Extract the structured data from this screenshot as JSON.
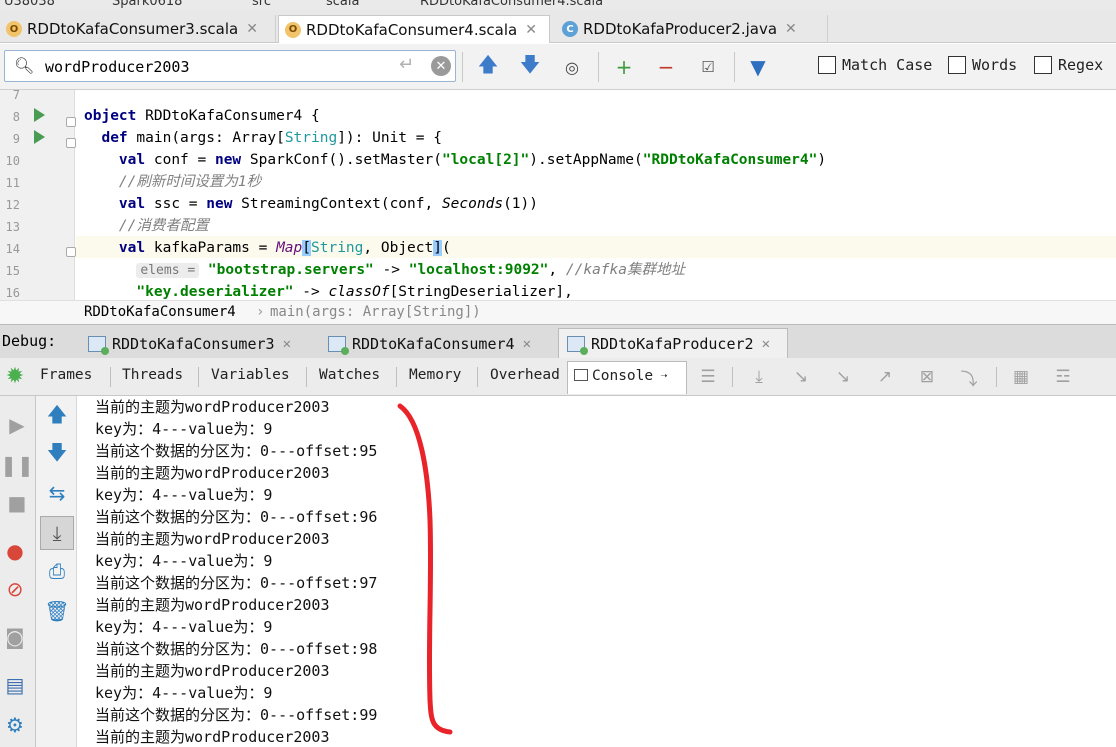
{
  "top_crumbs": [
    "U38038",
    "Spark0618",
    "src",
    "scala",
    "RDDtoKafaConsumer4.scala"
  ],
  "editor_tabs": [
    {
      "label": "RDDtoKafaConsumer3.scala",
      "icon": "scala-object-icon",
      "active": false
    },
    {
      "label": "RDDtoKafaConsumer4.scala",
      "icon": "scala-object-icon",
      "active": true
    },
    {
      "label": "RDDtoKafaProducer2.java",
      "icon": "java-class-icon",
      "active": false
    }
  ],
  "search": {
    "value": "wordProducer2003",
    "match_case_label": "Match Case",
    "words_label": "Words",
    "regex_label": "Regex"
  },
  "editor": {
    "line_numbers": [
      "7",
      "8",
      "9",
      "10",
      "11",
      "12",
      "13",
      "14",
      "15",
      "16"
    ],
    "comment_line11": "//刷新时间设置为1秒",
    "comment_line13": "//消费者配置",
    "hint_elems": "elems =",
    "str_local": "\"local[2]\"",
    "str_appname": "\"RDDtoKafaConsumer4\"",
    "str_bootstrap": "\"bootstrap.servers\"",
    "str_localhost": "\"localhost:9092\"",
    "comment_kafka": "//kafka集群地址",
    "str_keydeser": "\"key.deserializer\""
  },
  "breadcrumb": {
    "object": "RDDtoKafaConsumer4",
    "method": "main(args: Array[String])"
  },
  "debug": {
    "label": "Debug:",
    "tabs": [
      "RDDtoKafaConsumer3",
      "RDDtoKafaConsumer4",
      "RDDtoKafaProducer2"
    ]
  },
  "debugger_tabs": [
    "Frames",
    "Threads",
    "Variables",
    "Watches",
    "Memory",
    "Overhead",
    "Console"
  ],
  "console_lines": [
    "当前的主题为wordProducer2003",
    "key为：4---value为：9",
    "当前这个数据的分区为：0---offset:95",
    "当前的主题为wordProducer2003",
    "key为：4---value为：9",
    "当前这个数据的分区为：0---offset:96",
    "当前的主题为wordProducer2003",
    "key为：4---value为：9",
    "当前这个数据的分区为：0---offset:97",
    "当前的主题为wordProducer2003",
    "key为：4---value为：9",
    "当前这个数据的分区为：0---offset:98",
    "当前的主题为wordProducer2003",
    "key为：4---value为：9",
    "当前这个数据的分区为：0---offset:99",
    "当前的主题为wordProducer2003"
  ],
  "annotation_color": "#e8232a"
}
